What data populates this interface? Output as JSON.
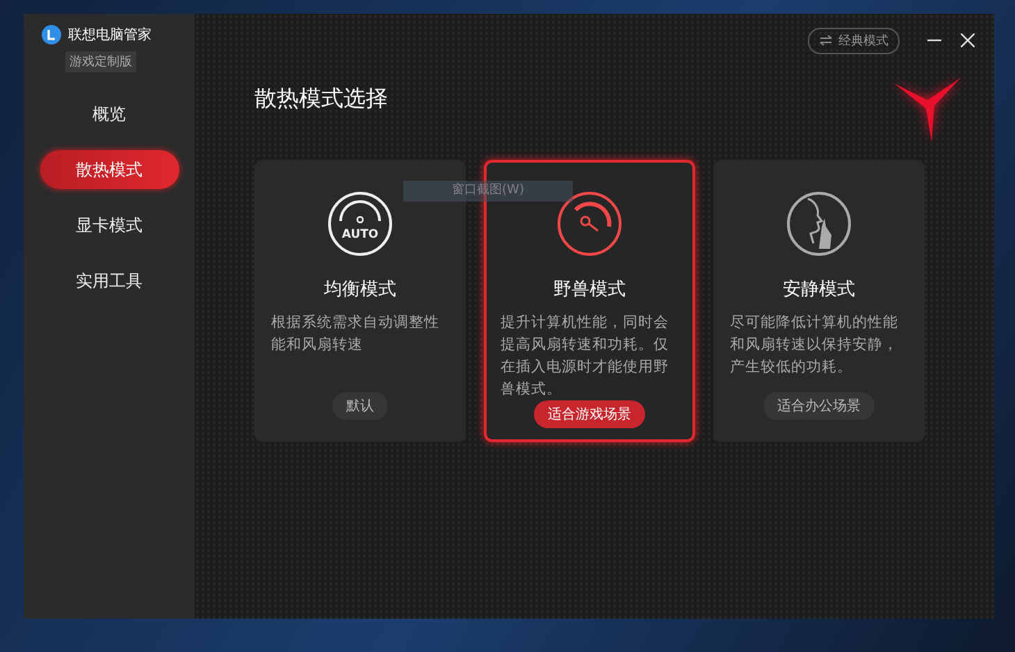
{
  "app": {
    "name": "联想电脑管家",
    "edition": "游戏定制版"
  },
  "sidebar": {
    "items": [
      {
        "label": "概览",
        "selected": false
      },
      {
        "label": "散热模式",
        "selected": true
      },
      {
        "label": "显卡模式",
        "selected": false
      },
      {
        "label": "实用工具",
        "selected": false
      }
    ]
  },
  "header": {
    "classic_mode_button": "经典模式"
  },
  "page_title": "散热模式选择",
  "modes": [
    {
      "kind": "auto",
      "icon_text": "AUTO",
      "title": "均衡模式",
      "description": "根据系统需求自动调整性能和风扇转速",
      "tag": "默认",
      "selected": false
    },
    {
      "kind": "beast",
      "title": "野兽模式",
      "description": "提升计算机性能，同时会提高风扇转速和功耗。仅在插入电源时才能使用野兽模式。",
      "tag": "适合游戏场景",
      "selected": true
    },
    {
      "kind": "quiet",
      "title": "安静模式",
      "description": "尽可能降低计算机的性能和风扇转速以保持安静，产生较低的功耗。",
      "tag": "适合办公场景",
      "selected": false
    }
  ],
  "tooltip": "窗口截图(W)"
}
